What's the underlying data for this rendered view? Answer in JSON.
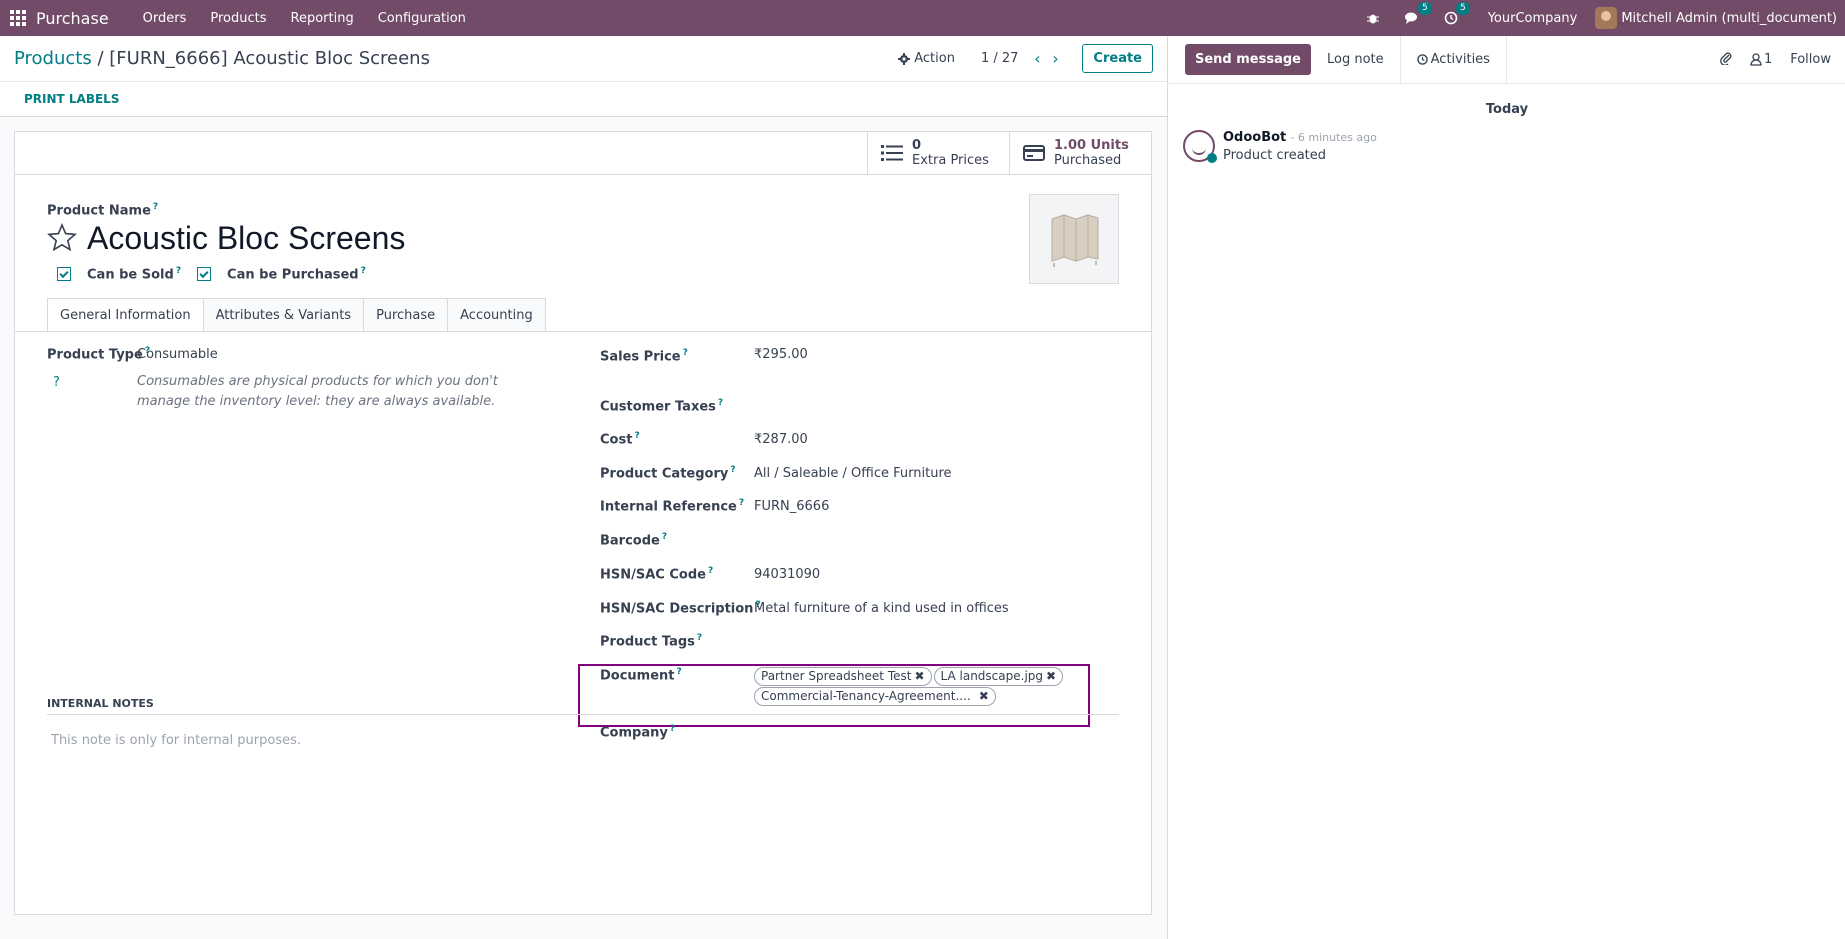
{
  "topbar": {
    "app_name": "Purchase",
    "menu": [
      "Orders",
      "Products",
      "Reporting",
      "Configuration"
    ],
    "messages_count": "5",
    "activities_count": "5",
    "company": "YourCompany",
    "user": "Mitchell Admin (multi_document)"
  },
  "control_panel": {
    "breadcrumb_parent": "Products",
    "breadcrumb_sep": "/",
    "breadcrumb_current": "[FURN_6666] Acoustic Bloc Screens",
    "action_label": "Action",
    "pager": "1 / 27",
    "create_label": "Create"
  },
  "statusbar": {
    "print_labels": "PRINT LABELS"
  },
  "stat_buttons": {
    "extra_prices_value": "0",
    "extra_prices_label": "Extra Prices",
    "purchased_value": "1.00 Units",
    "purchased_label": "Purchased"
  },
  "product": {
    "name_label": "Product Name",
    "name": "Acoustic Bloc Screens",
    "can_be_sold": "Can be Sold",
    "can_be_purchased": "Can be Purchased"
  },
  "tabs": [
    "General Information",
    "Attributes & Variants",
    "Purchase",
    "Accounting"
  ],
  "fields": {
    "product_type_label": "Product Type",
    "product_type": "Consumable",
    "product_type_help": "Consumables are physical products for which you don't manage the inventory level: they are always available.",
    "sales_price_label": "Sales Price",
    "sales_price": "₹295.00",
    "customer_taxes_label": "Customer Taxes",
    "cost_label": "Cost",
    "cost": "₹287.00",
    "category_label": "Product Category",
    "category": "All / Saleable / Office Furniture",
    "internal_ref_label": "Internal Reference",
    "internal_ref": "FURN_6666",
    "barcode_label": "Barcode",
    "hsn_code_label": "HSN/SAC Code",
    "hsn_code": "94031090",
    "hsn_desc_label": "HSN/SAC Description",
    "hsn_desc": "Metal furniture of a kind used in offices",
    "tags_label": "Product Tags",
    "document_label": "Document",
    "documents": [
      "Partner Spreadsheet Test",
      "LA landscape.jpg",
      "Commercial-Tenancy-Agreement...."
    ],
    "company_label": "Company"
  },
  "notes": {
    "heading": "INTERNAL NOTES",
    "placeholder": "This note is only for internal purposes."
  },
  "chatter": {
    "send_message": "Send message",
    "log_note": "Log note",
    "activities": "Activities",
    "followers_count": "1",
    "follow": "Follow",
    "today": "Today",
    "author": "OdooBot",
    "time": "- 6 minutes ago",
    "body": "Product created"
  },
  "colors": {
    "brand": "#714b67",
    "accent": "#017e84",
    "highlight": "#800080"
  }
}
